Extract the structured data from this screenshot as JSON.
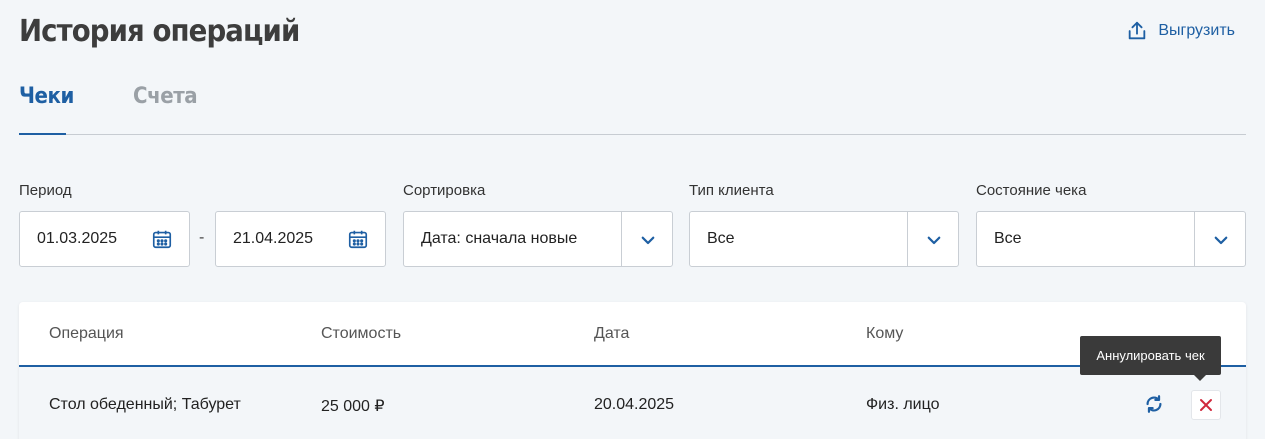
{
  "header": {
    "title": "История операций",
    "export_label": "Выгрузить"
  },
  "tabs": [
    {
      "label": "Чеки",
      "active": true
    },
    {
      "label": "Счета",
      "active": false
    }
  ],
  "filters": {
    "period": {
      "label": "Период",
      "from": "01.03.2025",
      "to": "21.04.2025",
      "separator": "-"
    },
    "sort": {
      "label": "Сортировка",
      "value": "Дата: сначала новые"
    },
    "client_type": {
      "label": "Тип клиента",
      "value": "Все"
    },
    "check_state": {
      "label": "Состояние чека",
      "value": "Все"
    }
  },
  "table": {
    "columns": [
      "Операция",
      "Стоимость",
      "Дата",
      "Кому"
    ],
    "rows": [
      {
        "operation": "Стол обеденный; Табурет",
        "cost": "25 000 ₽",
        "date": "20.04.2025",
        "recipient": "Физ. лицо"
      }
    ]
  },
  "tooltip": {
    "text": "Аннулировать чек"
  },
  "colors": {
    "accent": "#1e5fa3",
    "cancel": "#d0283c",
    "background": "#f3f6f9",
    "tooltip_bg": "#3a3a3a"
  },
  "icons": {
    "export": "upload-icon",
    "calendar": "calendar-icon",
    "dropdown": "chevron-down-icon",
    "refresh": "refresh-icon",
    "cancel": "close-icon"
  }
}
